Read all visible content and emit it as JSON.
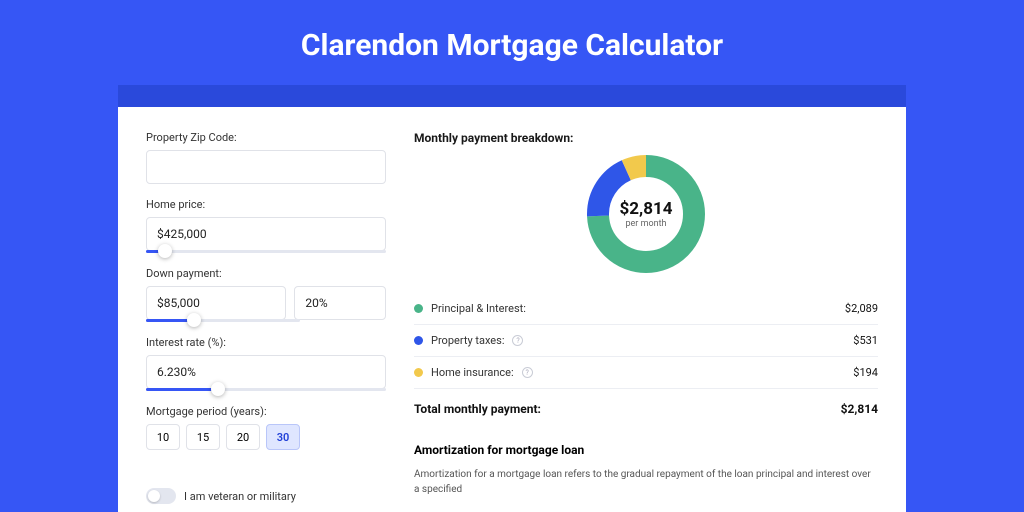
{
  "title": "Clarendon Mortgage Calculator",
  "form": {
    "zip": {
      "label": "Property Zip Code:",
      "value": ""
    },
    "home_price": {
      "label": "Home price:",
      "value": "$425,000",
      "slider_pct": 8
    },
    "down_payment": {
      "label": "Down payment:",
      "amount": "$85,000",
      "pct": "20%",
      "slider_pct": 20
    },
    "interest": {
      "label": "Interest rate (%):",
      "value": "6.230%",
      "slider_pct": 30
    },
    "period": {
      "label": "Mortgage period (years):",
      "options": [
        "10",
        "15",
        "20",
        "30"
      ],
      "selected": "30"
    },
    "veteran_label": "I am veteran or military"
  },
  "breakdown": {
    "heading": "Monthly payment breakdown:",
    "center_amount": "$2,814",
    "center_sub": "per month",
    "items": [
      {
        "label": "Principal & Interest:",
        "value": "$2,089",
        "color": "#49b489",
        "info": false
      },
      {
        "label": "Property taxes:",
        "value": "$531",
        "color": "#2f56e8",
        "info": true
      },
      {
        "label": "Home insurance:",
        "value": "$194",
        "color": "#f2c94c",
        "info": true
      }
    ],
    "total_label": "Total monthly payment:",
    "total_value": "$2,814"
  },
  "chart_data": {
    "type": "pie",
    "title": "Monthly payment breakdown",
    "series": [
      {
        "name": "Principal & Interest",
        "value": 2089,
        "color": "#49b489"
      },
      {
        "name": "Property taxes",
        "value": 531,
        "color": "#2f56e8"
      },
      {
        "name": "Home insurance",
        "value": 194,
        "color": "#f2c94c"
      }
    ],
    "total": 2814,
    "center_label": "$2,814 per month"
  },
  "amort": {
    "heading": "Amortization for mortgage loan",
    "text": "Amortization for a mortgage loan refers to the gradual repayment of the loan principal and interest over a specified"
  },
  "colors": {
    "accent": "#3656f5"
  }
}
